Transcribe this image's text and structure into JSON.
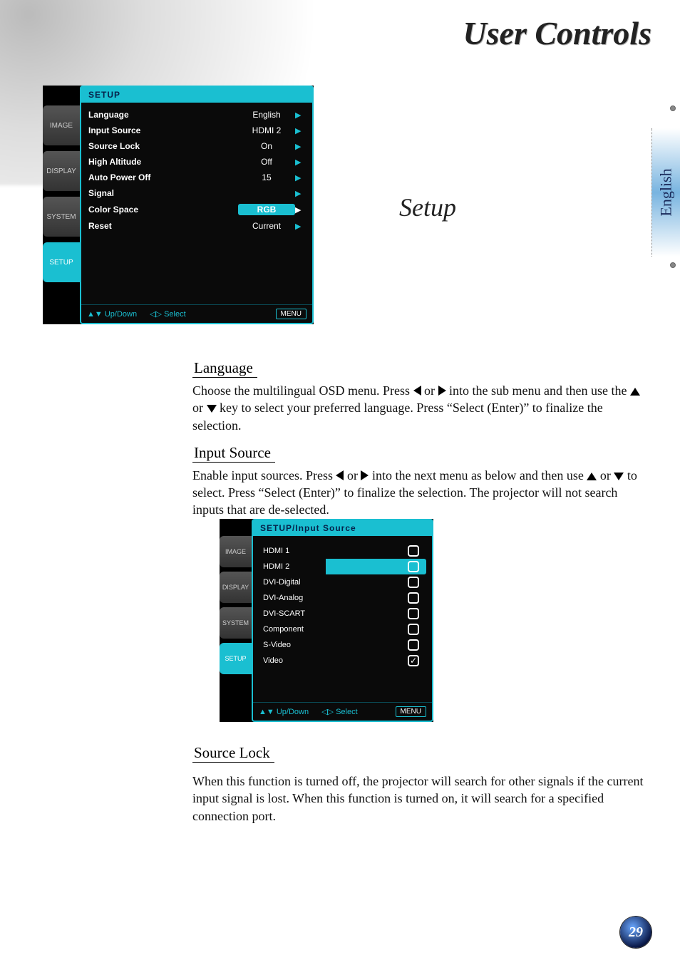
{
  "page": {
    "title": "User Controls",
    "section_title": "Setup",
    "language_tab": "English",
    "page_number": "29"
  },
  "osd_tabs": {
    "image": "IMAGE",
    "display": "DISPLAY",
    "system": "SYSTEM",
    "setup": "SETUP"
  },
  "osd1": {
    "header": "SETUP",
    "rows": [
      {
        "label": "Language",
        "value": "English"
      },
      {
        "label": "Input Source",
        "value": "HDMI 2"
      },
      {
        "label": "Source Lock",
        "value": "On"
      },
      {
        "label": "High Altitude",
        "value": "Off"
      },
      {
        "label": "Auto Power Off",
        "value": "15"
      },
      {
        "label": "Signal",
        "value": ""
      },
      {
        "label": "Color Space",
        "value": "RGB",
        "highlight": true
      },
      {
        "label": "Reset",
        "value": "Current"
      }
    ],
    "footer": {
      "updown": "Up/Down",
      "select": "Select",
      "menu": "MENU"
    }
  },
  "osd2": {
    "header": "SETUP/Input Source",
    "rows": [
      {
        "label": "HDMI 1",
        "checked": false
      },
      {
        "label": "HDMI 2",
        "checked": false,
        "highlight": true
      },
      {
        "label": "DVI-Digital",
        "checked": false
      },
      {
        "label": "DVI-Analog",
        "checked": false
      },
      {
        "label": "DVI-SCART",
        "checked": false
      },
      {
        "label": "Component",
        "checked": false
      },
      {
        "label": "S-Video",
        "checked": false
      },
      {
        "label": "Video",
        "checked": true
      }
    ],
    "footer": {
      "updown": "Up/Down",
      "select": "Select",
      "menu": "MENU"
    }
  },
  "sections": {
    "language": {
      "heading": "Language",
      "p1a": "Choose the multilingual OSD menu. Press ",
      "p1b": " or ",
      "p1c": "  into the sub menu and then use the  ",
      "p1d": " or ",
      "p1e": " key to select your preferred language. Press “Select (Enter)” to finalize the selection."
    },
    "input_source": {
      "heading": "Input Source",
      "p1a": "Enable input sources. Press ",
      "p1b": " or ",
      "p1c": " into the next menu as below and then use ",
      "p1d": " or ",
      "p1e": " to select. Press “Select (Enter)” to finalize the selection. The projector will not search inputs that are de-selected."
    },
    "source_lock": {
      "heading": "Source Lock",
      "p1": "When this function is turned off, the projector will search for other signals if the current input signal is lost. When this function is turned on, it will search for a specified connection port."
    }
  }
}
